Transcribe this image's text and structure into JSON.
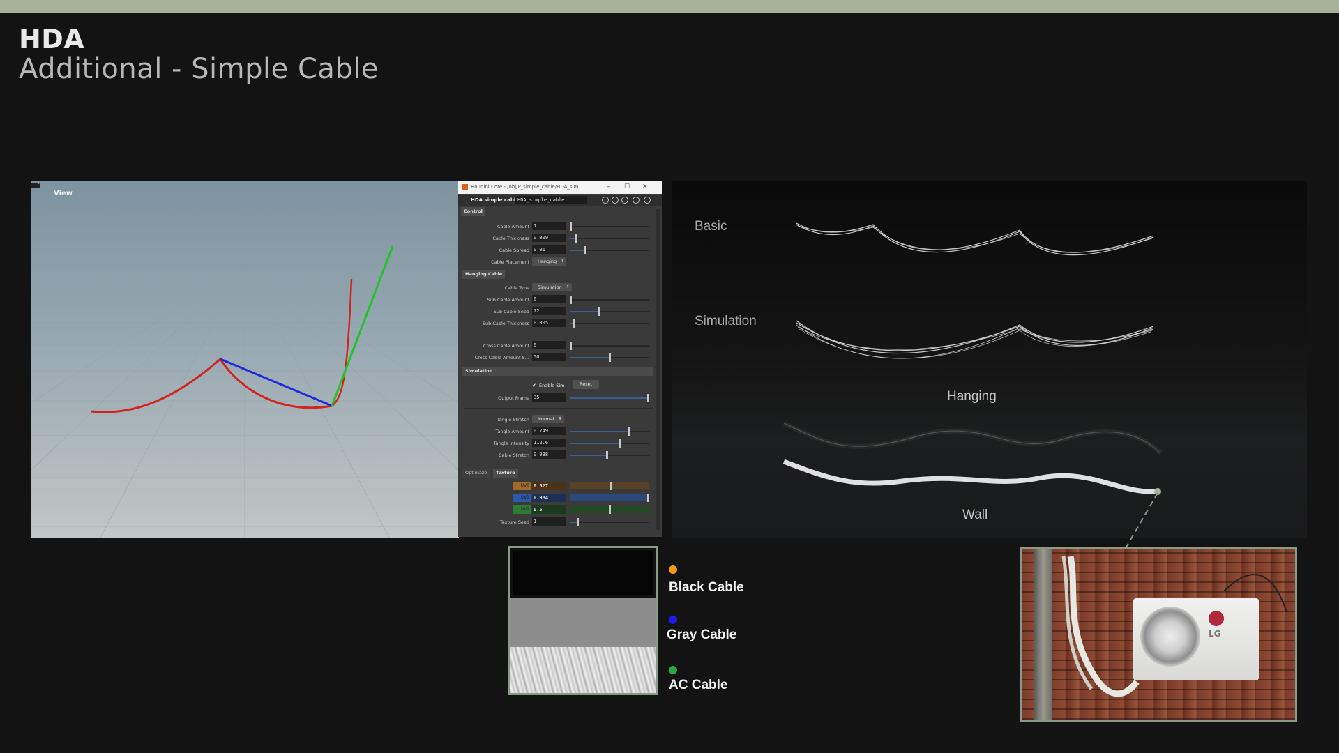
{
  "header": {
    "title": "HDA",
    "subtitle": "Additional - Simple Cable"
  },
  "viewport": {
    "label": "View"
  },
  "panel": {
    "window_title": "Houdini Core - /obj/P_simple_cable/HDA_sim...",
    "node_type": "HDA simple cable",
    "node_name": "HDA_simple_cable",
    "tabs_top": [
      "Control"
    ],
    "section_hanging": "Hanging Cable",
    "section_simulation": "Simulation",
    "tabs_bottom": [
      "Optimaze",
      "Texture"
    ],
    "params": {
      "cable_amount": {
        "label": "Cable Amount",
        "value": "1"
      },
      "cable_thickness": {
        "label": "Cable Thickness",
        "value": "0.009"
      },
      "cable_spread": {
        "label": "Cable Spread",
        "value": "0.01"
      },
      "cable_placement": {
        "label": "Cable Placement",
        "value": "Hanging"
      },
      "cable_type": {
        "label": "Cable Type",
        "value": "Simulation"
      },
      "sub_cable_amount": {
        "label": "Sub Cable Amount",
        "value": "0"
      },
      "sub_cable_seed": {
        "label": "Sub Cable Seed",
        "value": "72"
      },
      "sub_cable_thickness": {
        "label": "Sub Cable Thickness",
        "value": "0.005"
      },
      "cross_cable_amount": {
        "label": "Cross Cable Amount",
        "value": "0"
      },
      "cross_cable_amount_s": {
        "label": "Cross Cable Amount S...",
        "value": "50"
      },
      "enable_sim": {
        "label": "Enable Sim"
      },
      "reset": {
        "label": "Reset"
      },
      "output_frame": {
        "label": "Output Frame",
        "value": "35"
      },
      "tangle_stratch": {
        "label": "Tangle Stratch",
        "value": "Normal"
      },
      "tangle_amount": {
        "label": "Tangle Amount",
        "value": "0.749"
      },
      "tangle_intensity": {
        "label": "Tangle Intensity",
        "value": "112.6"
      },
      "cable_stretch": {
        "label": "Cable Stretch",
        "value": "0.938"
      },
      "uv0": {
        "label": "UV0",
        "value": "0.527"
      },
      "uv1": {
        "label": "UV1",
        "value": "0.984"
      },
      "uv2": {
        "label": "UV2",
        "value": "0.5"
      },
      "texture_seed": {
        "label": "Texture Seed",
        "value": "1"
      }
    }
  },
  "render_labels": {
    "basic": "Basic",
    "simulation": "Simulation",
    "hanging": "Hanging",
    "wall": "Wall"
  },
  "legend": [
    {
      "label": "Black Cable",
      "color": "#f59a12"
    },
    {
      "label": "Gray Cable",
      "color": "#1a1aee"
    },
    {
      "label": "AC Cable",
      "color": "#2ba83a"
    }
  ],
  "photo": {
    "brand": "LG"
  },
  "colors": {
    "background": "#121312",
    "topbar": "#a9b19a",
    "frame": "#8a9a88",
    "curve_red": "#d3231f",
    "curve_blue": "#1f2bd8",
    "curve_green": "#22c32a"
  }
}
